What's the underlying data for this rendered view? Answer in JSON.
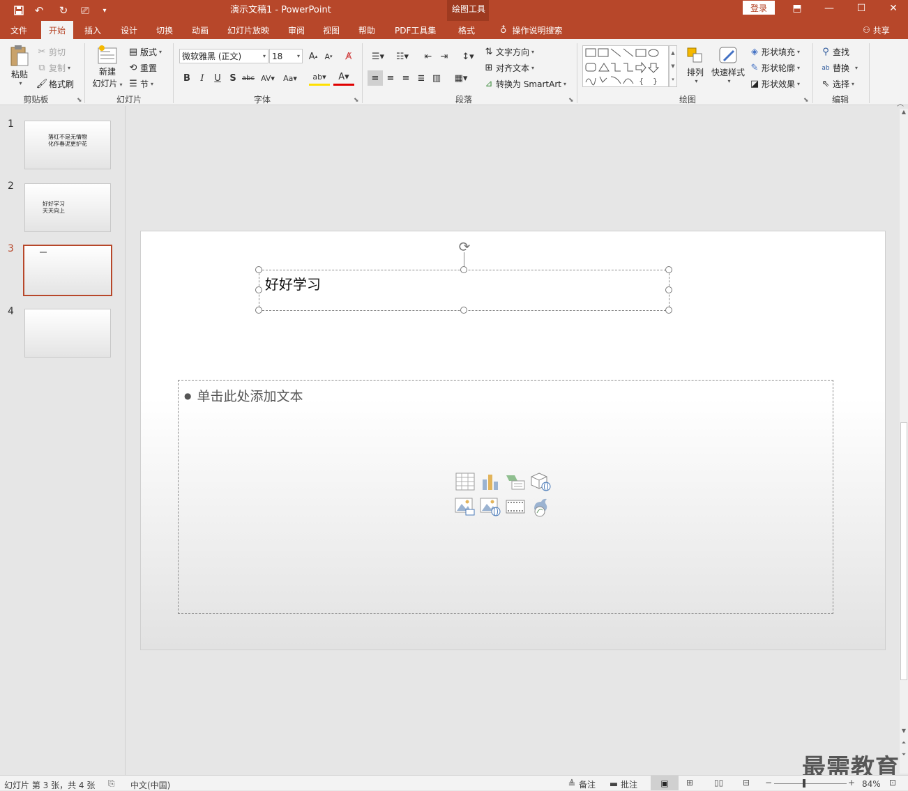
{
  "window": {
    "title": "演示文稿1  -  PowerPoint",
    "contextual_group": "绘图工具",
    "login": "登录"
  },
  "tabs": {
    "file": "文件",
    "home": "开始",
    "insert": "插入",
    "design": "设计",
    "transitions": "切换",
    "animations": "动画",
    "slideshow": "幻灯片放映",
    "review": "审阅",
    "view": "视图",
    "help": "帮助",
    "pdf": "PDF工具集",
    "format": "格式",
    "tell_me": "操作说明搜索",
    "share": "共享"
  },
  "ribbon": {
    "clipboard": {
      "paste": "粘贴",
      "cut": "剪切",
      "copy": "复制",
      "format_painter": "格式刷",
      "label": "剪贴板"
    },
    "slides": {
      "new_slide_1": "新建",
      "new_slide_2": "幻灯片",
      "layout": "版式",
      "reset": "重置",
      "section": "节",
      "label": "幻灯片"
    },
    "font": {
      "font_name": "微软雅黑 (正文)",
      "font_size": "18",
      "label": "字体"
    },
    "paragraph": {
      "text_direction": "文字方向",
      "align_text": "对齐文本",
      "smartart": "转换为 SmartArt",
      "label": "段落"
    },
    "drawing": {
      "arrange": "排列",
      "quick_styles": "快速样式",
      "shape_fill": "形状填充",
      "shape_outline": "形状轮廓",
      "shape_effects": "形状效果",
      "label": "绘图"
    },
    "editing": {
      "find": "查找",
      "replace": "替换",
      "select": "选择",
      "label": "编辑"
    }
  },
  "slides_panel": [
    {
      "num": "1",
      "line1": "落红不是无情物",
      "line2": "化作春泥更护花"
    },
    {
      "num": "2",
      "line1": "好好学习",
      "line2": "天天向上"
    },
    {
      "num": "3",
      "line1": "",
      "line2": ""
    },
    {
      "num": "4",
      "line1": "",
      "line2": ""
    }
  ],
  "slide": {
    "title_text": "好好学习",
    "content_placeholder": "单击此处添加文本"
  },
  "statusbar": {
    "slide_info": "幻灯片 第 3 张，共 4 张",
    "language": "中文(中国)",
    "notes": "备注",
    "comments": "批注",
    "zoom": "84%"
  },
  "watermark": "最需教育",
  "colors": {
    "accent": "#b7472a",
    "ribbon_bg": "#f3f3f3"
  }
}
